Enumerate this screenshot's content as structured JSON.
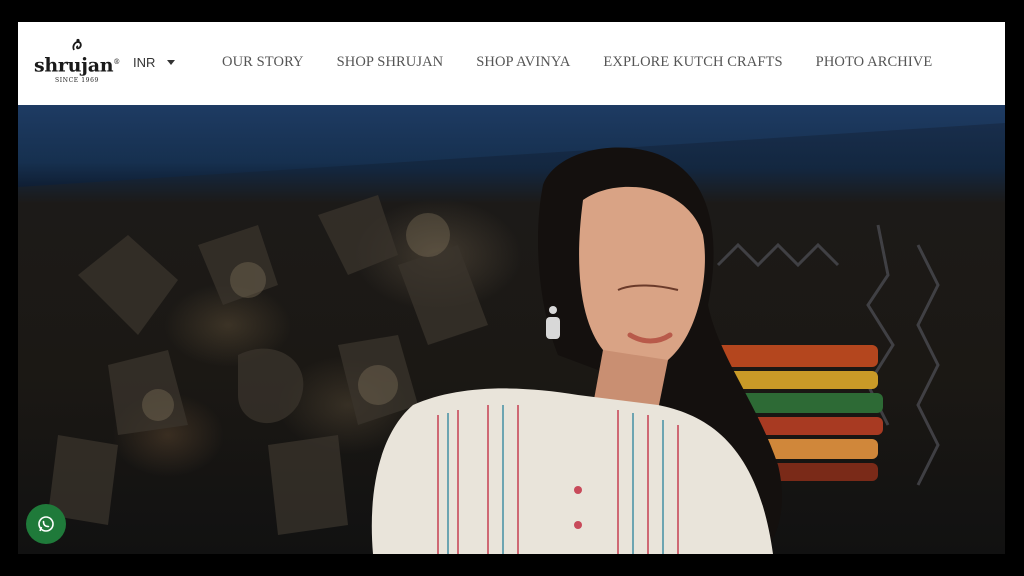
{
  "header": {
    "logo": {
      "wordmark": "shrujan",
      "registered": "®",
      "since": "SINCE 1969"
    },
    "currency": {
      "selected": "INR",
      "icon": "caret-down-icon"
    },
    "nav": [
      {
        "label": "OUR STORY"
      },
      {
        "label": "SHOP SHRUJAN"
      },
      {
        "label": "SHOP AVINYA"
      },
      {
        "label": "EXPLORE KUTCH CRAFTS"
      },
      {
        "label": "PHOTO ARCHIVE"
      }
    ]
  },
  "hero": {
    "image": "model-in-embroidered-kurta",
    "colors": {
      "wall": "#1e3b63",
      "background": "#1b1814"
    }
  },
  "floating": {
    "whatsapp": {
      "icon": "whatsapp-icon",
      "color": "#1f7a3a"
    }
  }
}
